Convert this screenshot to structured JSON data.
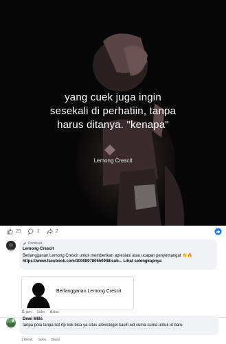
{
  "post": {
    "quote_lines": [
      "yang cuek juga ingin",
      "sesekali di perhatiin, tanpa",
      "harus ditanya. \"kenapa\""
    ],
    "watermark": "Lemong Crescit"
  },
  "reactions": {
    "likes": "25",
    "comments": "2",
    "shares": "2"
  },
  "comments": [
    {
      "badge": "Pembuat",
      "author": "Lemong Crescit",
      "text": "Berlangganan Lemong Crescit untuk memberikan apresiasi atau ucapan penyemangat 👏🔥",
      "link": "https://www.facebook.com/100089780550948/sub...",
      "see_more": "Lihat selengkapnya",
      "card_title": "Berlangganan Lemong Crescit",
      "time": "11 jam",
      "like": "Suka",
      "reply": "Balas"
    },
    {
      "author": "Dewi Mills",
      "text": "tanpa pola tanpa liat rtp kok bisa ya situs alexistogel kasih wd cuma cuma untuk id baru",
      "time": "1 menit",
      "like": "Suka",
      "reply": "Balas"
    }
  ],
  "colors": {
    "image_bg": "#070707",
    "reaction_blue": "#1877f2",
    "bubble_bg": "#f0f2f5",
    "muted_text": "#65676b"
  }
}
